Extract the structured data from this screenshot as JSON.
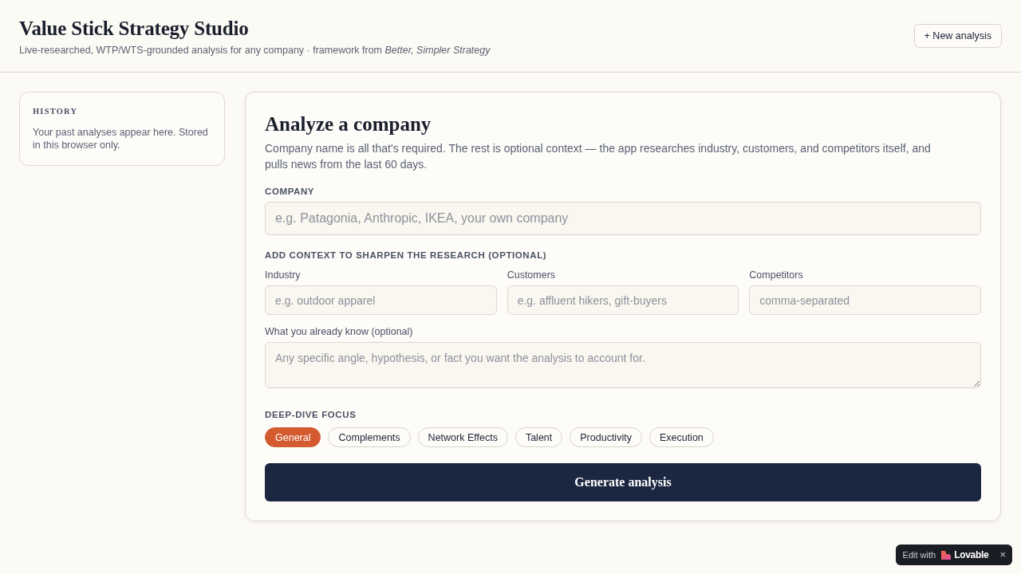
{
  "header": {
    "title": "Value Stick Strategy Studio",
    "subtitle": "Live-researched, WTP/WTS-grounded analysis for any company · framework from *Better, Simpler Strategy*",
    "new_button": "+ New analysis"
  },
  "history": {
    "heading": "HISTORY",
    "text": "Your past analyses appear here. Stored in this browser only."
  },
  "form": {
    "title": "Analyze a company",
    "description": "Company name is all that's required. The rest is optional context — the app researches industry, customers, and competitors itself, and pulls news from the last 60 days.",
    "company": {
      "label": "COMPANY",
      "placeholder": "e.g. Patagonia, Anthropic, IKEA, your own company"
    },
    "context_heading": "ADD CONTEXT TO SHARPEN THE RESEARCH (OPTIONAL)",
    "context_fields": [
      {
        "label": "Industry",
        "placeholder": "e.g. outdoor apparel"
      },
      {
        "label": "Customers",
        "placeholder": "e.g. affluent hikers, gift-buyers"
      },
      {
        "label": "Competitors",
        "placeholder": "comma-separated"
      }
    ],
    "notes": {
      "label": "What you already know (optional)",
      "placeholder": "Any specific angle, hypothesis, or fact you want the analysis to account for."
    },
    "focus_heading": "DEEP-DIVE FOCUS",
    "focus_options": [
      {
        "label": "General",
        "selected": true
      },
      {
        "label": "Complements",
        "selected": false
      },
      {
        "label": "Network Effects",
        "selected": false
      },
      {
        "label": "Talent",
        "selected": false
      },
      {
        "label": "Productivity",
        "selected": false
      },
      {
        "label": "Execution",
        "selected": false
      }
    ],
    "submit": "Generate analysis"
  },
  "edit_badge": {
    "prefix": "Edit with",
    "brand": "Lovable",
    "close": "×"
  }
}
